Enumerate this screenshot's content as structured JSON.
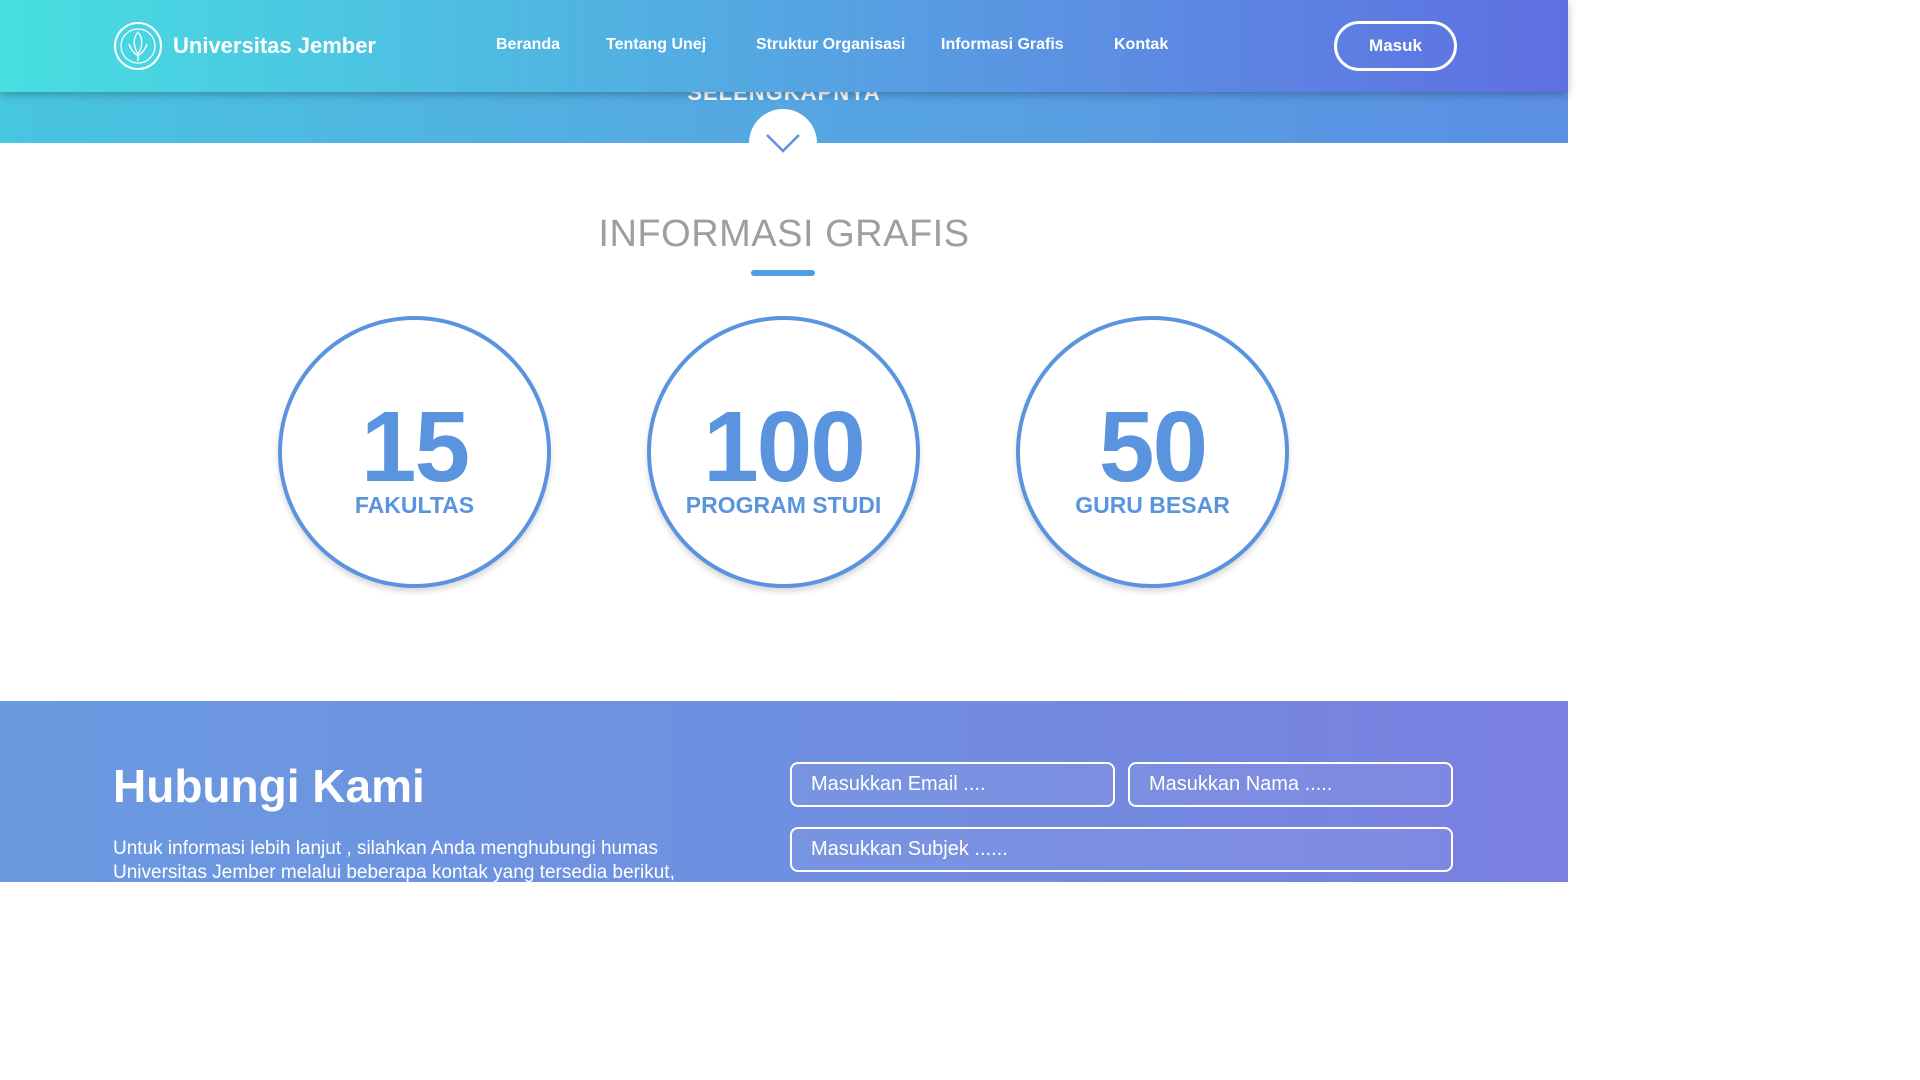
{
  "hero": {
    "more_text": "SELENGKAPNYA"
  },
  "navbar": {
    "brand_name": "Universitas Jember",
    "items": [
      {
        "label": "Beranda"
      },
      {
        "label": "Tentang Unej"
      },
      {
        "label": "Struktur Organisasi"
      },
      {
        "label": "Informasi Grafis"
      },
      {
        "label": "Kontak"
      }
    ],
    "login_label": "Masuk"
  },
  "info": {
    "title": "INFORMASI GRAFIS",
    "stats": [
      {
        "number": "15",
        "label": "FAKULTAS"
      },
      {
        "number": "100",
        "label": "PROGRAM STUDI"
      },
      {
        "number": "50",
        "label": "GURU BESAR"
      }
    ]
  },
  "contact": {
    "title": "Hubungi Kami",
    "description": "Untuk informasi lebih lanjut , silahkan Anda menghubungi humas Universitas Jember melalui beberapa kontak yang tersedia berikut, atau",
    "email_placeholder": "Masukkan Email ....",
    "name_placeholder": "Masukkan Nama .....",
    "subject_placeholder": "Masukkan Subjek ......"
  },
  "colors": {
    "accent": "#5a94de",
    "title_gray": "#9e9e9e",
    "nav_gradient_start": "#46dfe0",
    "nav_gradient_end": "#5e6fe2"
  }
}
